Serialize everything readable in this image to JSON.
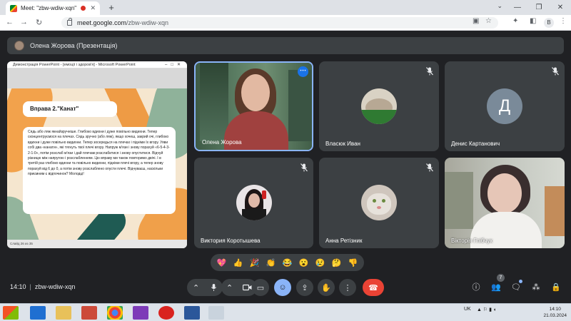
{
  "browser": {
    "tab_title": "Meet: \"zbw-wdiw-xqn\"",
    "url_host": "meet.google.com",
    "url_path": "/zbw-wdiw-xqn",
    "profile_initial": "B"
  },
  "presenter": {
    "label": "Олена Жорова (Презентація)"
  },
  "shared_screen": {
    "window_title": "Демонстрація PowerPoint - [емоції і здоров'я] - Microsoft PowerPoint",
    "slide_heading": "Вправа 2.\"Канат\"",
    "slide_text": "Сядь або ляж якнайзручніше. Глибоко вдихни і дуже повільно видихни. Тепер сконцентруємося на плечах. Сядь зручно (або ляж), якщо хочеш, закрий очі, глибоко вдихни і дуже повільно видихни. Тепер зосередься на плечах і підніми їх вгору. Уяви собі два «канати», які тягнуть твої плечі вгору. Напруж м'язи і знову порахуй «6-5-4-3-2-1-0», потім розслаб м'язи і дай плечам розслабитися і знову опуститися. Відчуй різницю між напругою і розслабленням. Цю вправу ми також повторимо двічі. І в третій раз глибоко вдихни та повільно видихни, підніми плечі вгору, а тепер знову порахуй від 6 до 0, а потім знову розслаблено опусти плечі. Відчуваєш, наскільки приємним є відпочинок? Молодці!",
    "status_text": "Слайд 26 из 35"
  },
  "participants": [
    {
      "name": "Олена Жорова"
    },
    {
      "name": "Власюк Иван"
    },
    {
      "name": "Денис Картанович",
      "initial": "Д"
    },
    {
      "name": "Виктория Коротышева"
    },
    {
      "name": "Анна Ретізник"
    },
    {
      "name": "Вікторія Глібчук"
    }
  ],
  "reactions": [
    "💖",
    "👍",
    "🎉",
    "👏",
    "😂",
    "😮",
    "😢",
    "🤔",
    "👎"
  ],
  "meeting": {
    "time": "14:10",
    "code": "zbw-wdiw-xqn",
    "participant_count": "7"
  },
  "taskbar": {
    "language": "UK",
    "time": "14:10",
    "date": "21.03.2024"
  },
  "colors": {
    "meet_bg": "#202124",
    "tile_bg": "#3c4043",
    "accent_blue": "#8ab4f8",
    "hangup_red": "#ea4335"
  }
}
